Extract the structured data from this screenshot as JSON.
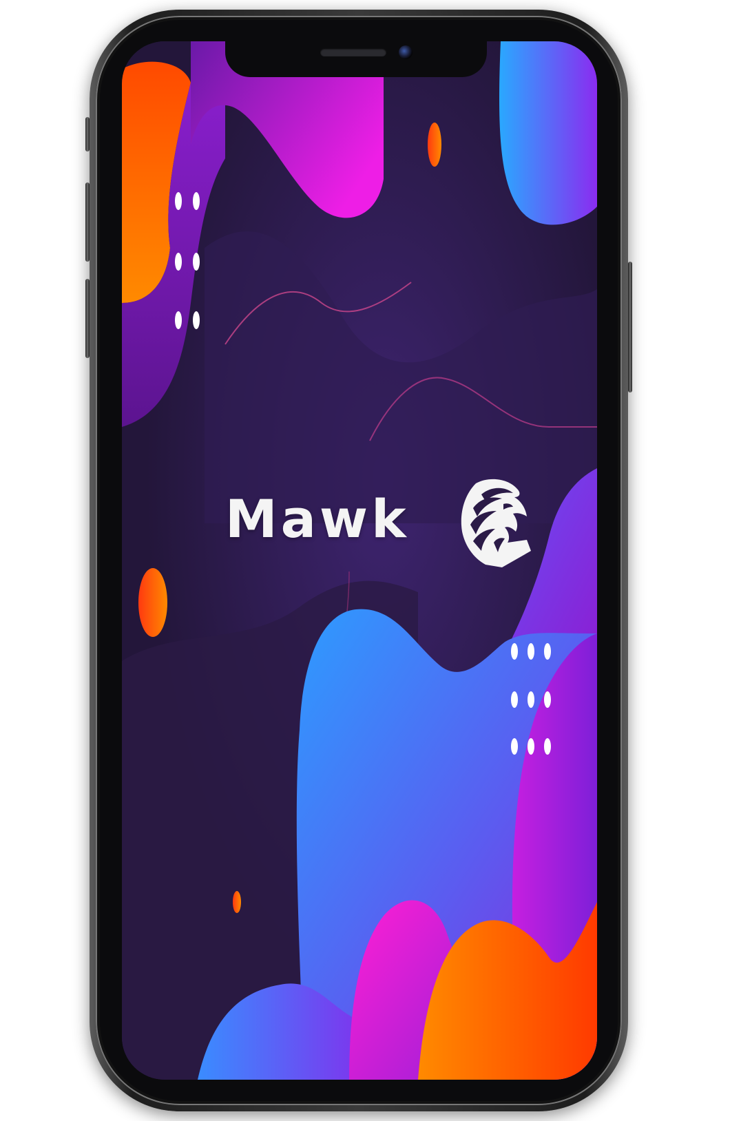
{
  "app": {
    "name": "Mawk",
    "logo_icon": "eagle-head-icon"
  },
  "device": {
    "model": "smartphone-mockup",
    "frame_color": "#1d1d1d"
  },
  "theme": {
    "background": "#27183f",
    "accent_orange": "#ff6a00",
    "accent_magenta": "#e51fe0",
    "accent_purple": "#7b2be0",
    "accent_blue": "#34a0ff",
    "text": "#f4f4f4"
  }
}
